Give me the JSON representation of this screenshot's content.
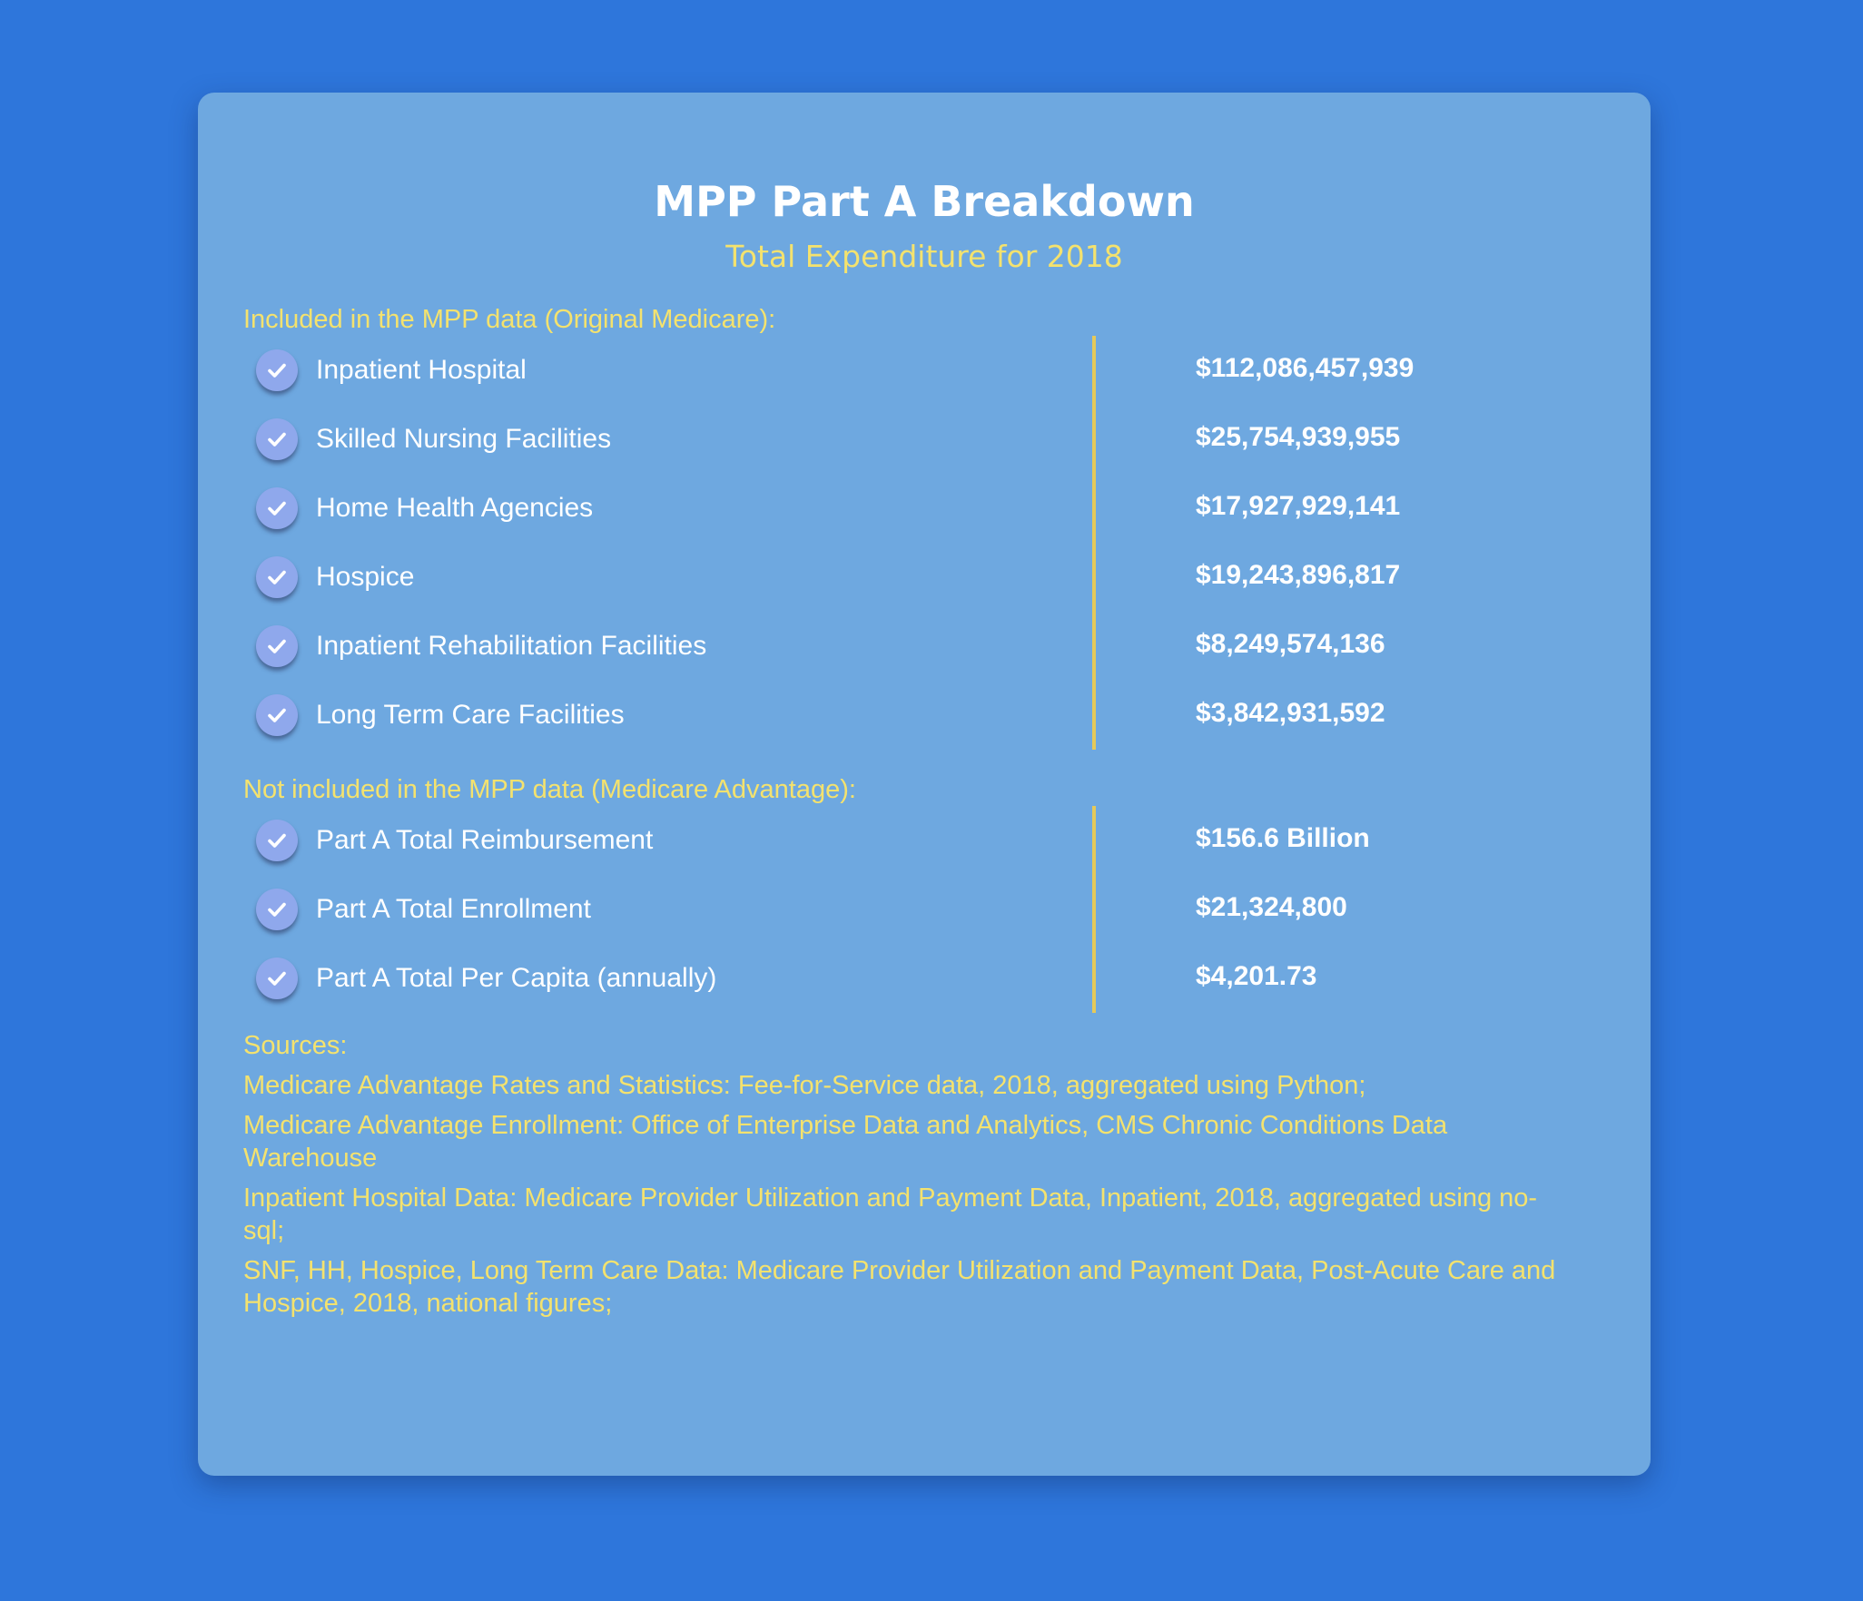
{
  "header": {
    "title": "MPP Part A Breakdown",
    "subtitle": "Total Expenditure for 2018"
  },
  "sections": [
    {
      "heading": "Included in the MPP data (Original Medicare):",
      "items": [
        {
          "label": "Inpatient Hospital",
          "value": "$112,086,457,939"
        },
        {
          "label": "Skilled Nursing Facilities",
          "value": "$25,754,939,955"
        },
        {
          "label": "Home Health Agencies",
          "value": "$17,927,929,141"
        },
        {
          "label": "Hospice",
          "value": "$19,243,896,817"
        },
        {
          "label": "Inpatient Rehabilitation Facilities",
          "value": "$8,249,574,136"
        },
        {
          "label": "Long Term Care Facilities",
          "value": "$3,842,931,592"
        }
      ]
    },
    {
      "heading": "Not included in the MPP data (Medicare Advantage):",
      "items": [
        {
          "label": "Part A Total Reimbursement",
          "value": "$156.6 Billion"
        },
        {
          "label": "Part A Total Enrollment",
          "value": "$21,324,800"
        },
        {
          "label": "Part A Total Per Capita (annually)",
          "value": "$4,201.73"
        }
      ]
    }
  ],
  "sources": {
    "heading": "Sources:",
    "lines": [
      "Medicare Advantage Rates and Statistics: Fee-for-Service data, 2018, aggregated using Python;",
      "Medicare Advantage Enrollment: Office of Enterprise Data and Analytics, CMS Chronic Conditions Data Warehouse",
      "Inpatient Hospital Data: Medicare Provider Utilization and Payment Data, Inpatient, 2018, aggregated using no-sql;",
      "SNF, HH, Hospice, Long Term Care Data: Medicare Provider Utilization and Payment Data, Post-Acute Care and Hospice, 2018, national figures;"
    ]
  },
  "colors": {
    "page_background": "#2e76db",
    "card_background": "#6ea8e0",
    "accent_yellow": "#f4e26e",
    "divider": "#e5c95a",
    "check_badge": "#8fa8ec"
  },
  "icons": {
    "item_marker": "check-icon"
  }
}
